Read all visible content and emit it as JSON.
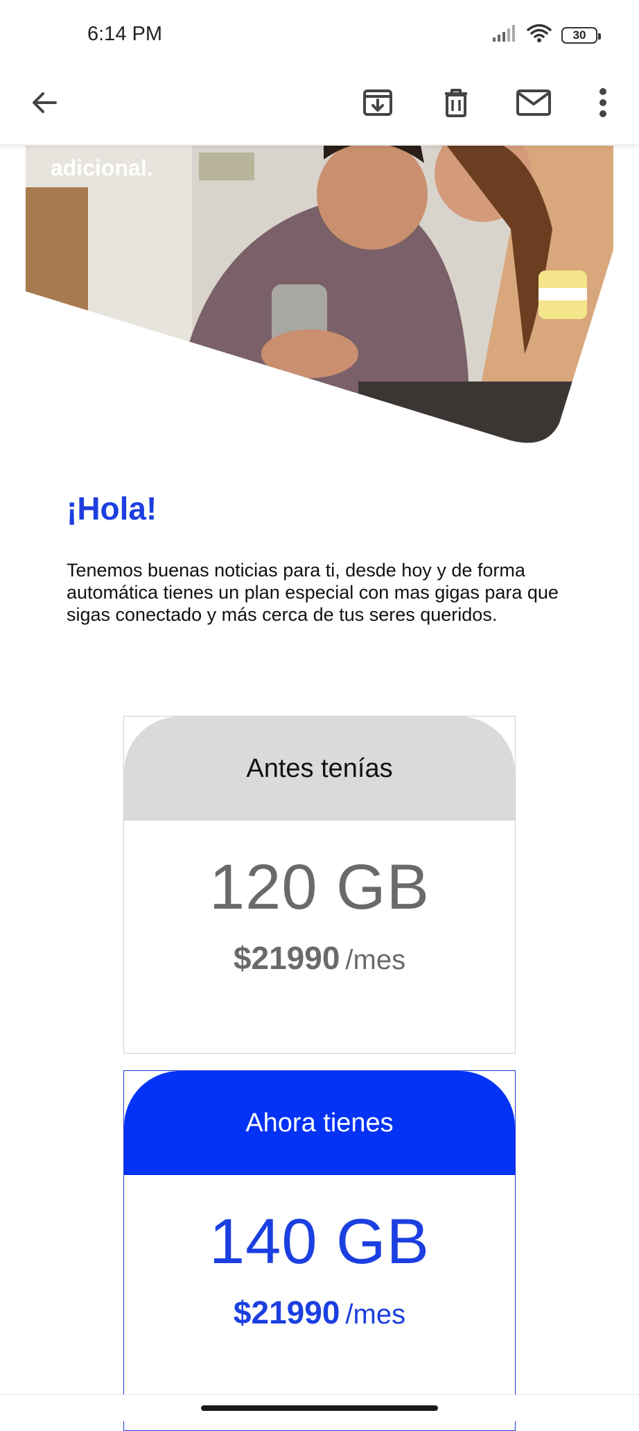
{
  "status_bar": {
    "time": "6:14 PM",
    "battery": "30"
  },
  "toolbar": {
    "icons": [
      "back-arrow-icon",
      "archive-icon",
      "trash-icon",
      "mail-icon",
      "more-vert-icon"
    ]
  },
  "email": {
    "hero_caption": "adicional.",
    "greeting": "¡Hola!",
    "intro": "Tenemos buenas noticias para ti, desde hoy y de forma automática tienes un plan especial con mas gigas para que sigas conectado y más cerca de tus seres queridos.",
    "plans": [
      {
        "header": "Antes tenías",
        "data": "120 GB",
        "price": "$21990",
        "unit": "/mes"
      },
      {
        "header": "Ahora tienes",
        "data": "140 GB",
        "price": "$21990",
        "unit": "/mes"
      }
    ]
  },
  "colors": {
    "accent": "#0433f5",
    "old_header": "#dadada",
    "old_text": "#6a6a6a"
  }
}
